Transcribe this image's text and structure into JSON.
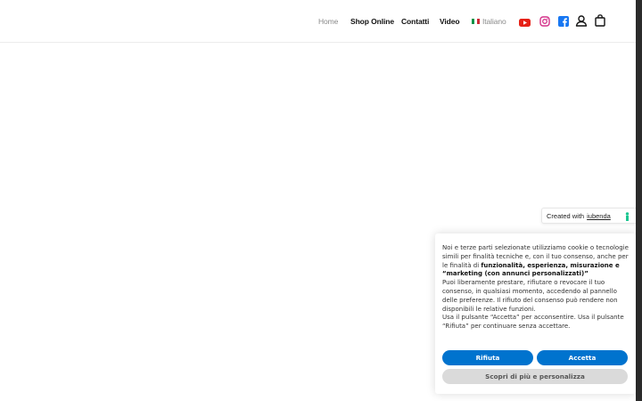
{
  "nav": {
    "home": "Home",
    "shop": "Shop Online",
    "contacts": "Contatti",
    "video": "Video",
    "language": "Italiano"
  },
  "icons": {
    "youtube": "youtube-icon",
    "instagram": "instagram-icon",
    "facebook": "facebook-icon",
    "account": "user-icon",
    "cart": "shopping-bag-icon"
  },
  "colors": {
    "youtube": "#e62117",
    "instagram": "#d43089",
    "facebook": "#1877f2",
    "primary_button": "#0073ce",
    "secondary_button": "#dadada"
  },
  "iubenda_badge": {
    "prefix": "Created with",
    "brand": "iubenda"
  },
  "cookie_banner": {
    "p1_text": "Noi e terze parti selezionate utilizziamo cookie o tecnologie simili per finalità tecniche e, con il tuo consenso, anche per le finalità di ",
    "p1_bold": "funzionalità, esperienza, misurazione e “marketing (con annunci personalizzati)”",
    "p2": "Puoi liberamente prestare, rifiutare o revocare il tuo consenso, in qualsiasi momento, accedendo al pannello delle preferenze. Il rifiuto del consenso può rendere non disponibili le relative funzioni.",
    "p3": "Usa il pulsante “Accetta” per acconsentire. Usa il pulsante “Rifiuta” per continuare senza accettare.",
    "reject_label": "Rifiuta",
    "accept_label": "Accetta",
    "customize_label": "Scopri di più e personalizza"
  }
}
